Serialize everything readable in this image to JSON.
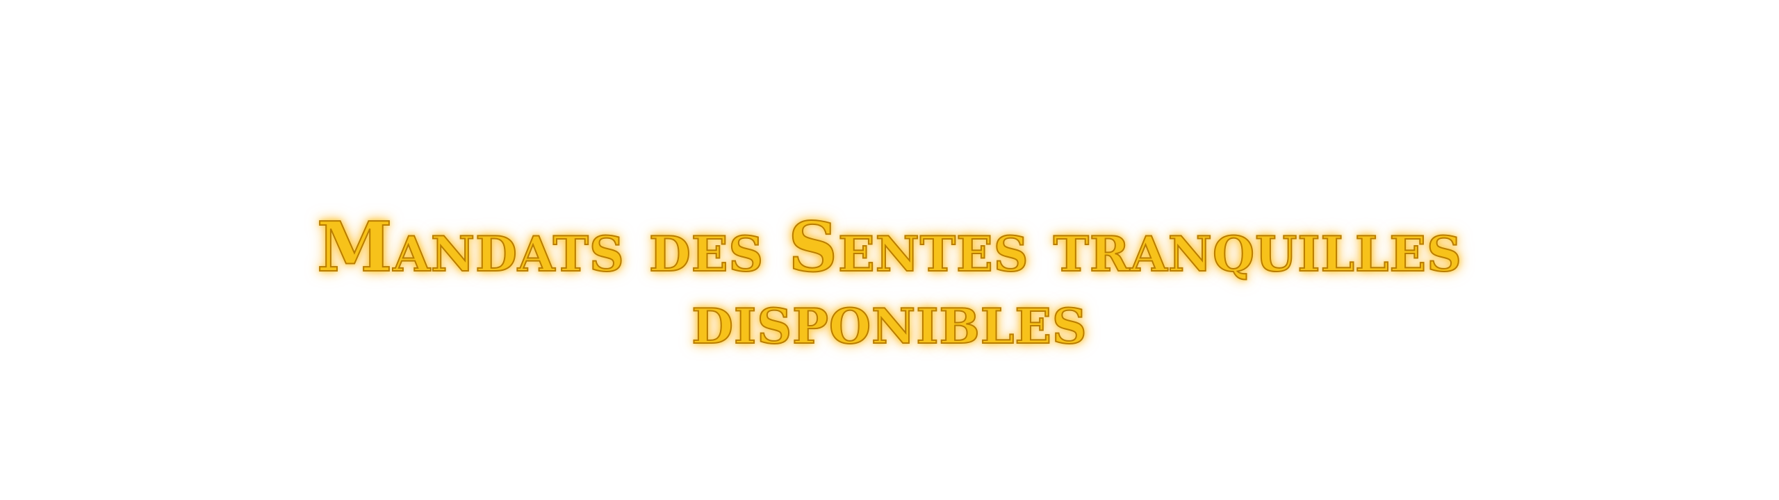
{
  "banner": {
    "title_line_1": "Mandats des Sentes tranquilles",
    "title_line_2": "disponibles",
    "text_color": "#f7c21a",
    "glow_color": "#ffcf45",
    "outline_color": "#b97c00"
  }
}
